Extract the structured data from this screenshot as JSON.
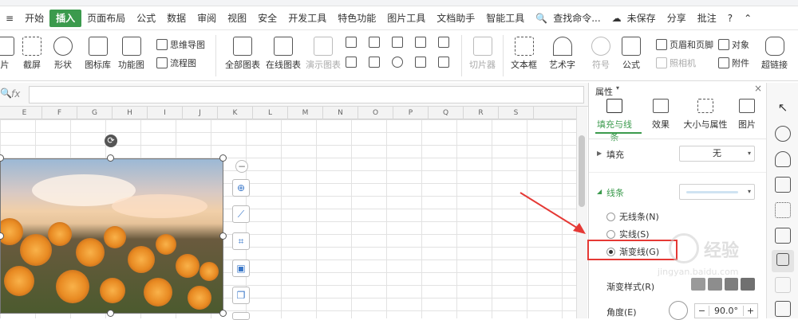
{
  "menubar": {
    "items": [
      "开始",
      "插入",
      "页面布局",
      "公式",
      "数据",
      "审阅",
      "视图",
      "安全",
      "开发工具",
      "特色功能",
      "图片工具",
      "文档助手",
      "智能工具"
    ],
    "active": "插入",
    "search": "查找命令...",
    "unsaved": "未保存",
    "share": "分享",
    "comment": "批注"
  },
  "ribbon": {
    "big": [
      "片",
      "截屏",
      "形状",
      "图标库",
      "功能图",
      "全部图表",
      "在线图表",
      "演示图表",
      "切片器",
      "文本框",
      "艺术字",
      "符号",
      "公式",
      "附件",
      "超链接"
    ],
    "small": [
      "思维导图",
      "流程图",
      "页眉和页脚",
      "对象",
      "照相机"
    ]
  },
  "formula_bar": {
    "fx": "fx",
    "value": ""
  },
  "columns": [
    "E",
    "F",
    "G",
    "H",
    "I",
    "J",
    "K",
    "L",
    "M",
    "N",
    "O",
    "P",
    "Q",
    "R",
    "S"
  ],
  "props": {
    "title": "属性",
    "tabs": [
      "填充与线条",
      "效果",
      "大小与属性",
      "图片"
    ],
    "active_tab": "填充与线条",
    "fill_label": "填充",
    "fill_value": "无",
    "line_label": "线条",
    "radios": [
      "无线条(N)",
      "实线(S)",
      "渐变线(G)"
    ],
    "selected_radio": "渐变线(G)",
    "gradient_style_label": "渐变样式(R)",
    "angle_label": "角度(E)",
    "angle_value": "90.0°",
    "minus": "−",
    "plus": "+"
  },
  "watermark": {
    "brand": "经验",
    "url": "jingyan.baidu.com"
  },
  "colors": {
    "accent": "#3b9a4d",
    "highlight": "#e53935"
  }
}
